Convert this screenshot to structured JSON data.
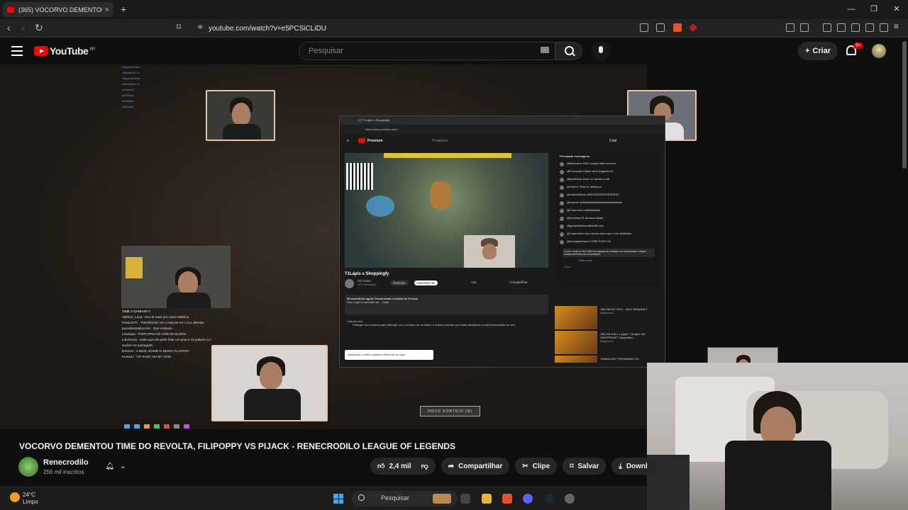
{
  "browser": {
    "tab_title": "(365) VOCORVO DEMENTOU TIME",
    "tab_close": "×",
    "new_tab": "+",
    "url": "youtube.com/watch?v=e5PCSiCLiDU",
    "window_controls": [
      "—",
      "❐",
      "✕"
    ]
  },
  "youtube": {
    "logo_text": "YouTube",
    "region": "BR",
    "search_placeholder": "Pesquisar",
    "create_label": "Criar",
    "notification_count": "9+"
  },
  "video_content": {
    "inner_tab": "(7) T1Lápis x Shoppingfy",
    "inner_url": "https://www.youtube.com/...",
    "inner_logo": "Premium",
    "inner_search": "Pesquisar",
    "inner_create": "Criar",
    "inner_video_title": "T1Lápis x Shoppingfy",
    "inner_channel": "Vô Corvo",
    "inner_channel_subs": "44,3 mil inscritos",
    "inner_join": "Participe",
    "inner_subscribe": "Inscrever-se",
    "inner_likes": "141",
    "inner_share": "Compartilhar",
    "inner_desc_1": "59 assistindo agora  Transmissão iniciada há 3 horas",
    "inner_desc_2": "Sou o que eu acredito ser ...mais",
    "inner_chat_title": "Chat ao vivo",
    "inner_chat_text": "Participe da conversa para interagir com o criador de conteúdo e outras pessoas que estão assistindo a esta transmissão ao vivo.",
    "inner_pill": "Assistindo o vídeo completo   Retornar ao clipe",
    "inner_top_chat": "Principais mensagens",
    "inner_chat_rows": [
      "@sfsazzero.4301  compra item xxxxxxx",
      "@Fernanda-C3pes  vai lá jogando mt",
      "@parllencia  xxxxx vo dando a call",
      "@Tcutes7  Boa né amassou",
      "@victorwWeise  AEEEEEEEEEEEEEEEE",
      "@nxpeon  kkkkkkkkkkkkkkkkkkkkkkkkkkkkkk",
      "@Cosentino1  kkkkkkkkkkk",
      "@eemfoxy  2k de dano kkkkk",
      "@garrafadelimaribeiro60  boa",
      "@Cosentino1  deu menos dano que o lulu kkkkkkkk",
      "@enmasdeboard  COME ELES VÔ"
    ],
    "inner_chat_notice": "Curta o chat ao vivo! Não se esqueça de proteger sua privacidade e seguir nossas diretrizes da comunidade.",
    "inner_chat_more": "Saiba mais",
    "inner_chat_input": "Chat...",
    "inner_recs": [
      {
        "title": "CBLOW AO VIVO - DIA 2 SEMANA 2",
        "channel": "Baiakuzao"
      },
      {
        "title": "CBLOW DIA 4 | Upper: T1Lápis 1x0 SHOPPINGFY Saopadice...",
        "channel": "Baiakuzao"
      },
      {
        "title": "THAAYLADY TREINANDO PA...",
        "channel": ""
      }
    ],
    "left_chat_top": [
      "Nogueira29ox :",
      "villeritas94 : k",
      "Nogueira29ox :",
      "villeritas94 : k",
      "erf3zinx3 :",
      "erf3zinx3 :",
      "erf3zinx3 :",
      "erf3zinx3 :"
    ],
    "left_chat_bottom": [
      "TIME A GANHAR !!",
      "Valthryr_Luna : isso tá mais pra carta maléfica",
      "PokazinTK : TWORKING VAI LANÇAR AS CALL BRABA",
      "pacedoestadocorvo : Que roubado.",
      "moonyaa : POPCORN ICE CREAM SILERS",
      "LuluzIvorp : avisa que ele pode falar um pouco na palavra q n souber em português",
      "lemorov : A BIDE, BOMB IS BEING PLANTED",
      "KumaJJ : OH KAMI, OH MY GOD"
    ],
    "sorteio": "NOVO SORTEIO (N)"
  },
  "video_meta": {
    "title": "VOCORVO DEMENTOU TIME DO REVOLTA, FILIPOPPY VS PIJACK - RENECRODILO LEAGUE OF LEGENDS",
    "channel_name": "Renecrodilo",
    "channel_subs": "256 mil inscritos",
    "like_count": "2,4 mil",
    "share_label": "Compartilhar",
    "clip_label": "Clipe",
    "save_label": "Salvar",
    "download_label": "Downl"
  },
  "taskbar": {
    "temperature": "24°C",
    "condition": "Limpo",
    "search_placeholder": "Pesquisar"
  },
  "colors": {
    "youtube_red": "#ff0000",
    "background": "#0f0f0f",
    "button_bg": "#272727"
  }
}
